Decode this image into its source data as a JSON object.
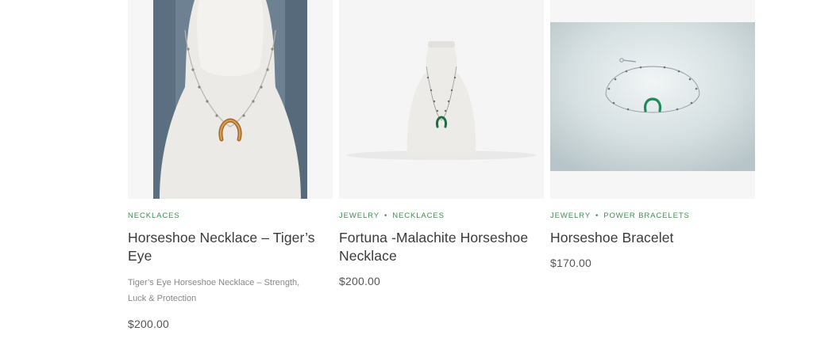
{
  "products": [
    {
      "categories": [
        "NECKLACES"
      ],
      "title": "Horseshoe Necklace – Tiger’s Eye",
      "description": "Tiger’s Eye Horseshoe Necklace – Strength, Luck & Protection",
      "price": "$200.00"
    },
    {
      "categories": [
        "JEWELRY",
        "NECKLACES"
      ],
      "title": "Fortuna -Malachite Horseshoe Necklace",
      "price": "$200.00"
    },
    {
      "categories": [
        "JEWELRY",
        "POWER BRACELETS"
      ],
      "title": "Horseshoe Bracelet",
      "price": "$170.00"
    }
  ],
  "colors": {
    "category_link": "#3c8f52",
    "title": "#3a3a3a",
    "price": "#555555",
    "card_bg": "#f6f6f6"
  }
}
